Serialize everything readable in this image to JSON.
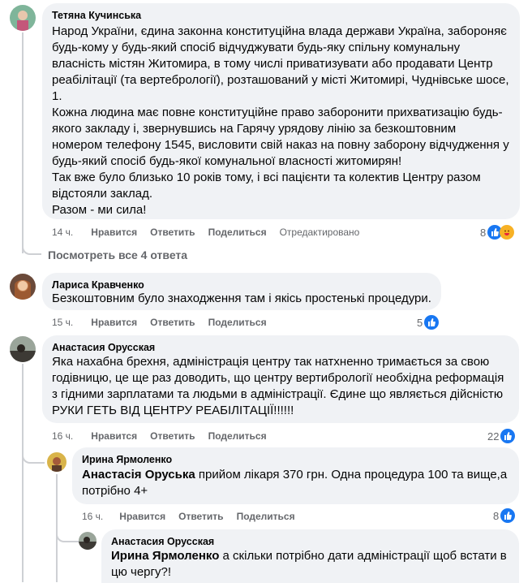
{
  "comments": [
    {
      "author": "Тетяна Кучинська",
      "lines": [
        "Народ України, єдина законна конституційна влада держави Україна, забороняє",
        "будь-кому у будь-який спосіб відчуджувати будь-яку спільну комунальну",
        "власність містян Житомира, в тому числі приватизувати або продавати Центр",
        "реабілітації (та вертебрології), розташований у місті Житомирі, Чуднівське шосе,",
        "1.",
        "Кожна людина має повне конституційне право заборонити прихватизацію будь-",
        "якого закладу і, звернувшись на Гарячу урядову лінію за безкоштовним",
        "номером телефону 1545, висловити свій наказ на повну заборону відчудження у",
        "будь-який спосіб будь-якої комунальної власності житомирян!",
        "Так вже було близько 10 років тому, і всі пацієнти та колектив Центру разом",
        "відстояли заклад.",
        "Разом - ми сила!"
      ],
      "time": "14 ч.",
      "like": "Нравится",
      "reply": "Ответить",
      "share": "Поделиться",
      "edited": "Отредактировано",
      "reactions": "8"
    },
    {
      "author": "Лариса Кравченко",
      "lines": [
        "Безкоштовним було знаходження там і якісь простенькі процедури."
      ],
      "time": "15 ч.",
      "like": "Нравится",
      "reply": "Ответить",
      "share": "Поделиться",
      "reactions": "5"
    },
    {
      "author": "Анастасия Орусская",
      "lines": [
        "Яка нахабна брехня, адміністрація центру так натхненно тримається за свою",
        "годівницю, це ще раз доводить, що центру вертибрології необхідна реформація",
        "з гідними зарплатами та людьми в адміністрації. Єдине що являється дійсністю",
        "РУКИ ГЕТЬ ВІД ЦЕНТРУ РЕАБІЛІТАЦІЇ!!!!!!"
      ],
      "time": "16 ч.",
      "like": "Нравится",
      "reply": "Ответить",
      "share": "Поделиться",
      "reactions": "22"
    }
  ],
  "view_replies": "Посмотреть все 4 ответа",
  "replies": [
    {
      "author": "Ирина Ярмоленко",
      "mention": "Анастасія Оруська",
      "line1_rest": " прийом лікаря 370 грн. Одна процедура 100 та вище,а",
      "line2": "потрібно 4+",
      "time": "16 ч.",
      "like": "Нравится",
      "reply": "Ответить",
      "share": "Поделиться",
      "reactions": "8"
    },
    {
      "author": "Анастасия Орусская",
      "mention": "Ирина Ярмоленко",
      "line1_rest": " а скільки потрібно дати адміністрації щоб встати в",
      "line2": "цю чергу?!"
    }
  ],
  "colors": {
    "like_blue": "#1877f2",
    "bubble": "#f0f2f5",
    "meta": "#65676b"
  }
}
